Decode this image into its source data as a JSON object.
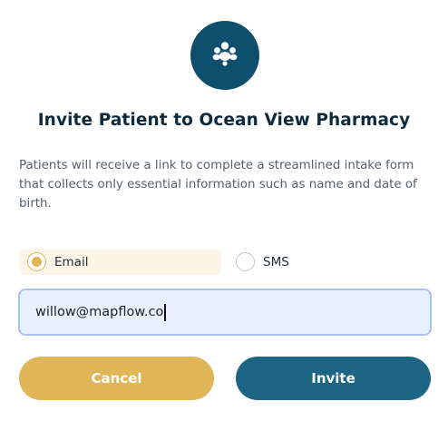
{
  "dialog": {
    "logo_icon": "people-group-icon",
    "title": "Invite Patient to Ocean View Pharmacy",
    "description": "Patients will receive a link to complete a streamlined intake form that collects only essential information such as name and date of birth."
  },
  "contact_method": {
    "options": [
      {
        "label": "Email",
        "selected": true
      },
      {
        "label": "SMS",
        "selected": false
      }
    ]
  },
  "contact_input": {
    "value": "willow@mapflow.co"
  },
  "actions": {
    "cancel_label": "Cancel",
    "invite_label": "Invite"
  },
  "colors": {
    "brand_dark": "#0f4f6e",
    "accent_gold": "#e1b658",
    "primary_button": "#1c6584",
    "input_bg": "#e8f0fd",
    "input_border": "#a9c3ea",
    "selected_option_bg": "#fcf4e6"
  }
}
